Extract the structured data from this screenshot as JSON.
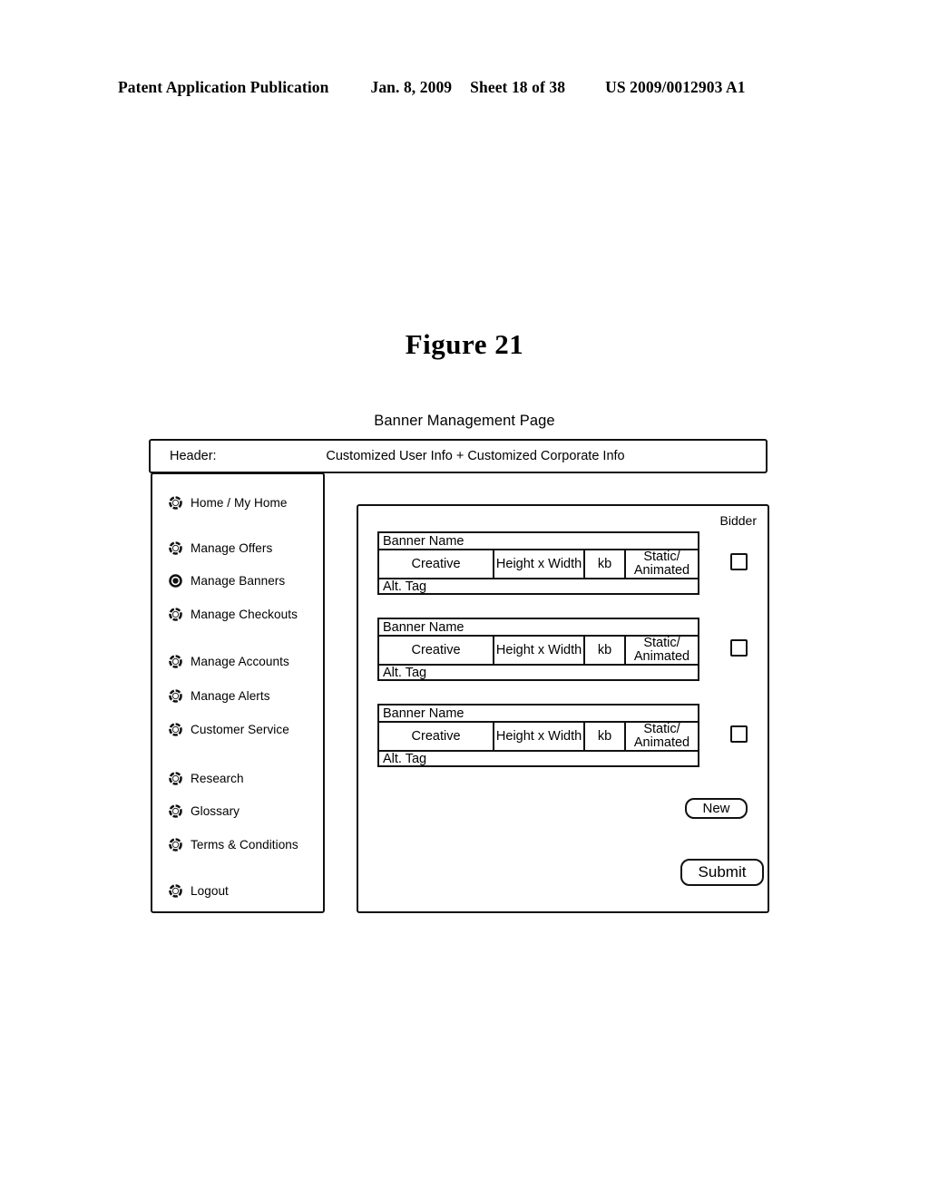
{
  "patent_header": {
    "publication": "Patent Application Publication",
    "date": "Jan. 8, 2009",
    "sheet": "Sheet 18 of 38",
    "doc_number": "US 2009/0012903 A1"
  },
  "figure": {
    "caption": "Figure 21",
    "page_title": "Banner Management Page"
  },
  "mock": {
    "header": {
      "label": "Header:",
      "value": "Customized User Info + Customized Corporate Info"
    },
    "sidebar": {
      "items": [
        {
          "label": "Home / My Home",
          "icon": "ring-icon",
          "selected": false
        },
        {
          "label": "Manage Offers",
          "icon": "ring-icon",
          "selected": false
        },
        {
          "label": "Manage Banners",
          "icon": "ring-filled-icon",
          "selected": true
        },
        {
          "label": "Manage Checkouts",
          "icon": "ring-icon",
          "selected": false
        },
        {
          "label": "Manage Accounts",
          "icon": "ring-icon",
          "selected": false
        },
        {
          "label": "Manage Alerts",
          "icon": "ring-icon",
          "selected": false
        },
        {
          "label": "Customer Service",
          "icon": "ring-icon",
          "selected": false
        },
        {
          "label": "Research",
          "icon": "ring-icon",
          "selected": false
        },
        {
          "label": "Glossary",
          "icon": "ring-icon",
          "selected": false
        },
        {
          "label": "Terms & Conditions",
          "icon": "ring-icon",
          "selected": false
        },
        {
          "label": "Logout",
          "icon": "ring-icon",
          "selected": false
        }
      ]
    },
    "content": {
      "bidder_column_label": "Bidder",
      "banner_rows": [
        {
          "name": "Banner Name",
          "creative": "Creative",
          "dimensions": "Height x Width",
          "size": "kb",
          "type": "Static/\nAnimated",
          "alt_tag": "Alt. Tag",
          "bidder_checked": false
        },
        {
          "name": "Banner Name",
          "creative": "Creative",
          "dimensions": "Height x Width",
          "size": "kb",
          "type": "Static/\nAnimated",
          "alt_tag": "Alt. Tag",
          "bidder_checked": false
        },
        {
          "name": "Banner Name",
          "creative": "Creative",
          "dimensions": "Height x Width",
          "size": "kb",
          "type": "Static/\nAnimated",
          "alt_tag": "Alt. Tag",
          "bidder_checked": false
        }
      ],
      "new_button": "New",
      "submit_button": "Submit"
    }
  },
  "colors": {
    "ink": "#111111",
    "paper": "#ffffff"
  }
}
